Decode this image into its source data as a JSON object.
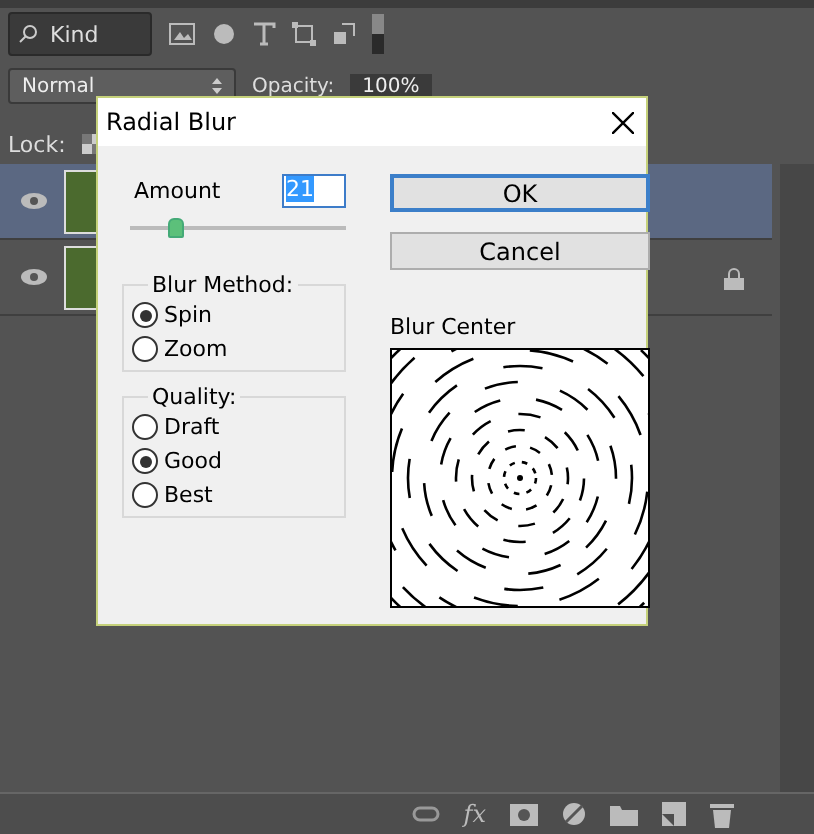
{
  "filter": {
    "label": "Kind"
  },
  "blend": {
    "mode": "Normal",
    "opacity_label": "Opacity:",
    "opacity": "100%"
  },
  "lock": {
    "label": "Lock:"
  },
  "layers": [
    {
      "visible": true,
      "selected": true,
      "locked": false
    },
    {
      "visible": true,
      "selected": false,
      "locked": true
    }
  ],
  "footer": {
    "fx": "fx"
  },
  "dialog": {
    "title": "Radial Blur",
    "amount_label": "Amount",
    "amount": "21",
    "level": 0.21,
    "buttons": [
      {
        "label": "OK",
        "default": true
      },
      {
        "label": "Cancel",
        "default": false
      }
    ],
    "blur_method": {
      "title": "Blur Method:",
      "options": [
        {
          "label": "Spin",
          "selected": true
        },
        {
          "label": "Zoom",
          "selected": false
        }
      ]
    },
    "quality": {
      "title": "Quality:",
      "options": [
        {
          "label": "Draft",
          "selected": false
        },
        {
          "label": "Good",
          "selected": true
        },
        {
          "label": "Best",
          "selected": false
        }
      ]
    },
    "blur_center": {
      "label": "Blur Center"
    }
  }
}
